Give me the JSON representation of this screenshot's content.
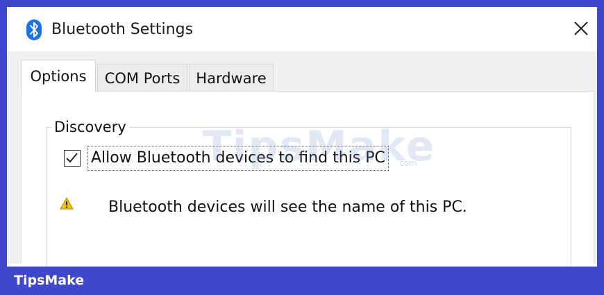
{
  "window": {
    "title": "Bluetooth Settings",
    "icon": "bluetooth-icon",
    "close_icon": "close-icon"
  },
  "tabs": [
    {
      "label": "Options",
      "selected": true
    },
    {
      "label": "COM Ports",
      "selected": false
    },
    {
      "label": "Hardware",
      "selected": false
    }
  ],
  "discovery": {
    "group_label": "Discovery",
    "checkbox_label": "Allow Bluetooth devices to find this PC",
    "checkbox_checked": true,
    "warning_icon": "warning-icon",
    "warning_text": "Bluetooth devices will see the name of this PC."
  },
  "watermark": {
    "text": "TipsMake",
    "sub": "com"
  },
  "banner": {
    "text": "TipsMake"
  },
  "colors": {
    "frame": "#3f48cc",
    "bluetooth_blue": "#1a73e8",
    "warning_yellow": "#f2c200"
  }
}
